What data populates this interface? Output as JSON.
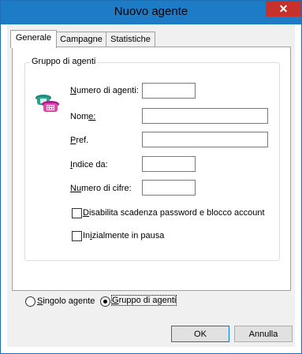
{
  "window": {
    "title": "Nuovo agente",
    "close_glyph": "✕"
  },
  "tabs": [
    {
      "label": "Generale",
      "active": true
    },
    {
      "label": "Campagne",
      "active": false
    },
    {
      "label": "Statistiche",
      "active": false
    }
  ],
  "group": {
    "title": "Gruppo di agenti",
    "icon": "phones-icon"
  },
  "fields": {
    "num_agents": {
      "label_u": "N",
      "label_rest": "umero di agenti:",
      "value": ""
    },
    "name": {
      "label_u": "N",
      "label_mid": "om",
      "label_rest": "e:",
      "value": ""
    },
    "pref": {
      "label_u": "P",
      "label_rest": "ref.",
      "value": ""
    },
    "index_from": {
      "label_u": "I",
      "label_rest": "ndice da:",
      "value": ""
    },
    "num_digits": {
      "label_u": "Nu",
      "label_rest": "mero di cifre:",
      "value": ""
    }
  },
  "checkboxes": {
    "disable_expiry": {
      "label_u": "D",
      "label_rest": "isabilita scadenza password e blocco account",
      "checked": false
    },
    "paused": {
      "label_pre": "In",
      "label_u": "i",
      "label_rest": "zialmente in pausa",
      "checked": false
    }
  },
  "radios": {
    "single": {
      "label_u": "S",
      "label_rest": "ingolo agente",
      "selected": false
    },
    "group": {
      "label_u": "G",
      "label_rest": "ruppo di agenti",
      "selected": true
    }
  },
  "buttons": {
    "ok": "OK",
    "cancel": "Annulla"
  }
}
